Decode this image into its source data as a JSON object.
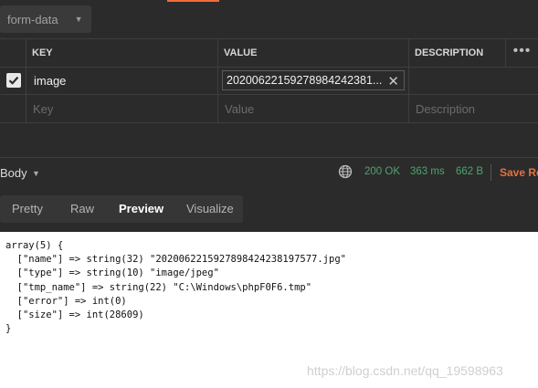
{
  "request": {
    "body_type": "form-data",
    "table": {
      "headers": {
        "key": "KEY",
        "value": "VALUE",
        "description": "DESCRIPTION"
      },
      "rows": [
        {
          "checked": true,
          "key": "image",
          "value": "20200622159278984242381..."
        }
      ],
      "placeholders": {
        "key": "Key",
        "value": "Value",
        "description": "Description"
      }
    }
  },
  "response": {
    "body_label": "Body",
    "status": "200 OK",
    "time": "363 ms",
    "size": "662 B",
    "save_label": "Save Re",
    "colors": {
      "status": "#4fa46b",
      "save": "#e8703d"
    }
  },
  "view_tabs": [
    {
      "label": "Pretty",
      "active": false
    },
    {
      "label": "Raw",
      "active": false
    },
    {
      "label": "Preview",
      "active": true
    },
    {
      "label": "Visualize",
      "active": false
    }
  ],
  "preview": {
    "lines": [
      "array(5) {",
      "  [\"name\"] => string(32) \"2020062215927898424238197577.jpg\"",
      "  [\"type\"] => string(10) \"image/jpeg\"",
      "  [\"tmp_name\"] => string(22) \"C:\\Windows\\phpF0F6.tmp\"",
      "  [\"error\"] => int(0)",
      "  [\"size\"] => int(28609)",
      "}"
    ],
    "watermark": "https://blog.csdn.net/qq_19598963"
  }
}
